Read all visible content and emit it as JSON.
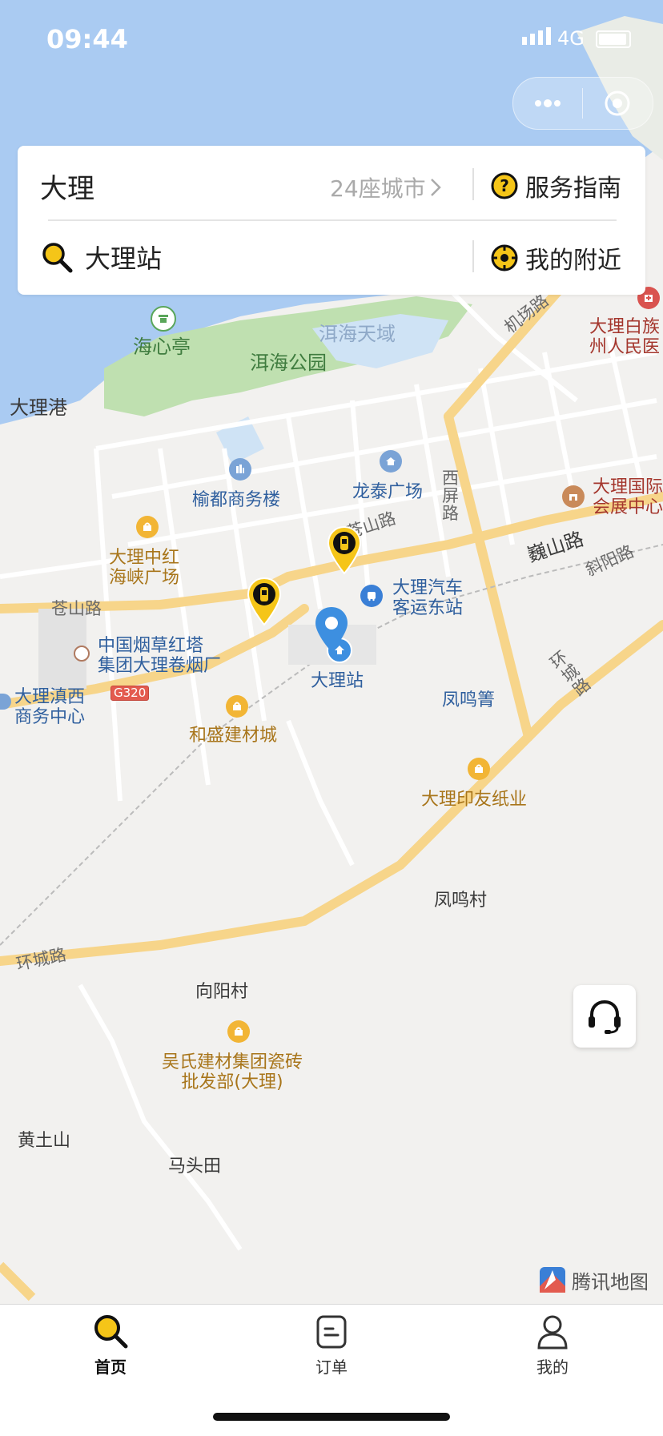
{
  "status_bar": {
    "time": "09:44",
    "network": "4G"
  },
  "search_card": {
    "city": "大理",
    "city_count": "24座城市",
    "service_guide": "服务指南",
    "station": "大理站",
    "nearby": "我的附近"
  },
  "map": {
    "labels": {
      "haixinting": "海心亭",
      "daligang": "大理港",
      "erhai_park": "洱海公园",
      "erhai_tianyu": "洱海天域",
      "jichang_road": "机场路",
      "bai_hospital": "大理白族\n州人民医",
      "yudu": "榆都商务楼",
      "longtai": "龙泰广场",
      "xiping_road": "西\n屏\n路",
      "convention": "大理国际\n会展中心",
      "cangshan_road_1": "苍山路",
      "zhonghong": "大理中红\n海峡广场",
      "weishan_road": "巍山路",
      "xieyang_road": "斜阳路",
      "cangshan_road_2": "苍山路",
      "bus_station": "大理汽车\n客运东站",
      "tobacco": "中国烟草红塔\n集团大理卷烟厂",
      "dali_station": "大理站",
      "dianxi": "大理滇西\n商务中心",
      "g320": "G320",
      "huancheng_road_1": "环\n城\n路",
      "fengmingjing": "凤鸣箐",
      "hesheng": "和盛建材城",
      "yinyou": "大理印友纸业",
      "fengming_village": "凤鸣村",
      "huancheng_road_2": "环城路",
      "xiangyang": "向阳村",
      "wushi": "吴氏建材集团瓷砖\n批发部(大理)",
      "huangtushan": "黄土山",
      "matoutian": "马头田"
    },
    "provider": "腾讯地图"
  },
  "tabbar": {
    "home": "首页",
    "orders": "订单",
    "mine": "我的"
  },
  "colors": {
    "accent": "#f5c518",
    "water": "#aacbf2",
    "park": "#bfe0b0",
    "road": "#ffffff",
    "main_road": "#f7d58a",
    "pin_blue": "#3d8fe0"
  }
}
